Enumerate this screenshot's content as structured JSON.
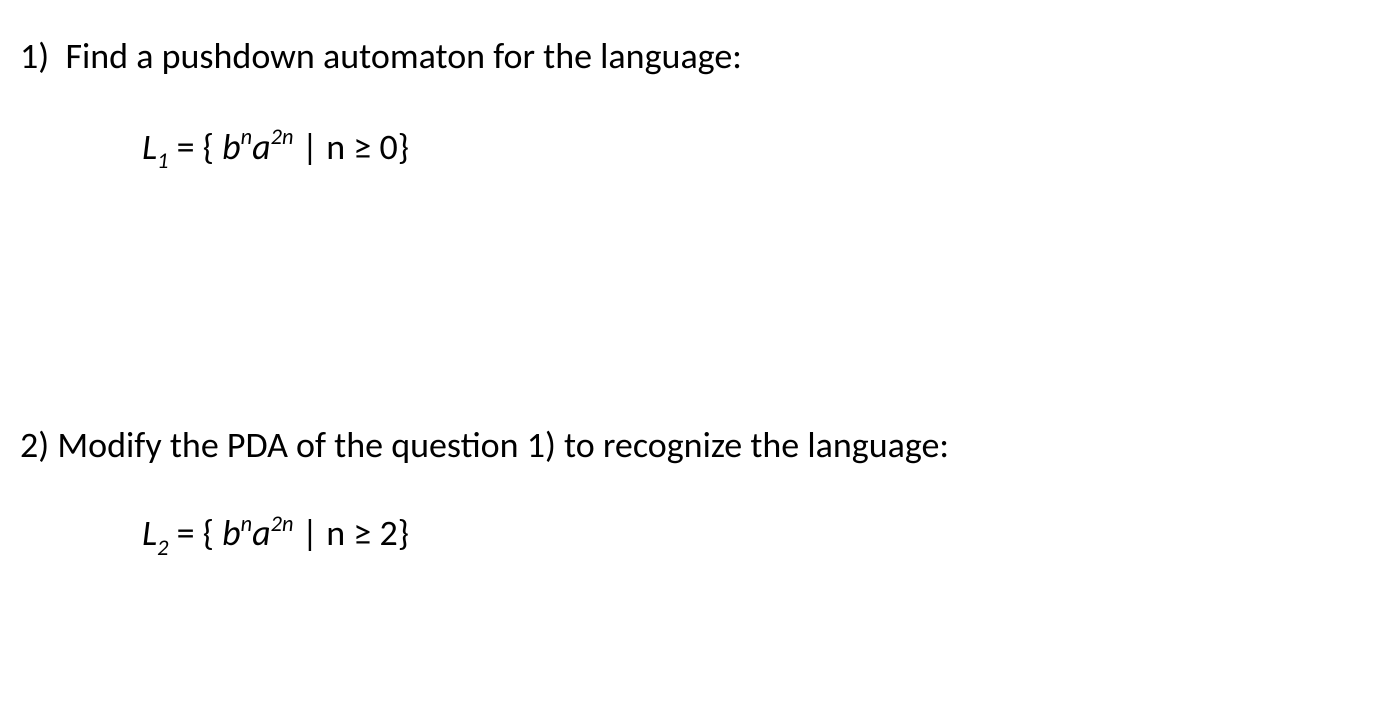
{
  "q1": {
    "number": "1)",
    "prompt": "Find a pushdown automaton for the language:",
    "formula": {
      "lhs_var": "L",
      "lhs_sub": "1",
      "eq": " = ",
      "lbrace": "{ ",
      "b": "b",
      "b_exp": "n",
      "a": "a",
      "a_exp": "2n",
      "bar": " | ",
      "cond_var": "n",
      "cond_op": " ≥ ",
      "cond_val": "0",
      "rbrace": "}"
    }
  },
  "q2": {
    "number": "2)",
    "prompt": "Modify the PDA of the question 1) to recognize the language:",
    "formula": {
      "lhs_var": "L",
      "lhs_sub": "2",
      "eq": " = ",
      "lbrace": "{ ",
      "b": "b",
      "b_exp": "n",
      "a": "a",
      "a_exp": "2n",
      "bar": " | ",
      "cond_var": "n",
      "cond_op": " ≥ ",
      "cond_val": "2",
      "rbrace": "}"
    }
  }
}
